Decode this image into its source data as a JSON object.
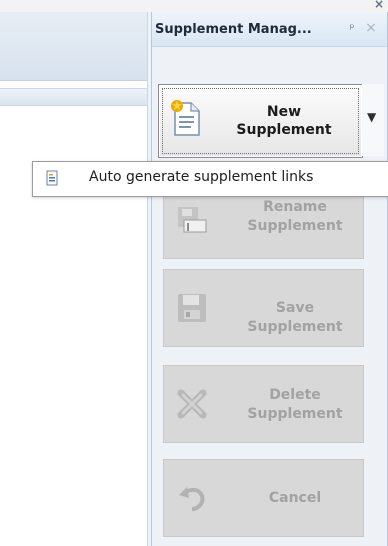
{
  "window": {
    "close_glyph": "×"
  },
  "panel": {
    "title": "Supplement Manag...",
    "pin_glyph": "ᵖ",
    "close_glyph": "×"
  },
  "actions": [
    {
      "label": "New Supplement",
      "icon": "document-star-icon",
      "enabled": true
    },
    {
      "label": "Rename Supplement",
      "icon": "rename-icon",
      "enabled": false
    },
    {
      "label": "Save Supplement",
      "icon": "floppy-disk-icon",
      "enabled": false
    },
    {
      "label": "Delete Supplement",
      "icon": "delete-x-icon",
      "enabled": false
    },
    {
      "label": "Cancel",
      "icon": "undo-icon",
      "enabled": false
    }
  ],
  "dropdown_menu": {
    "items": [
      {
        "label": "Auto generate supplement links",
        "icon": "document-links-icon"
      }
    ]
  },
  "colors": {
    "accent_header": "#d9e6f3",
    "disabled_button": "#d8d8d8",
    "disabled_text": "#a2a2a2"
  }
}
